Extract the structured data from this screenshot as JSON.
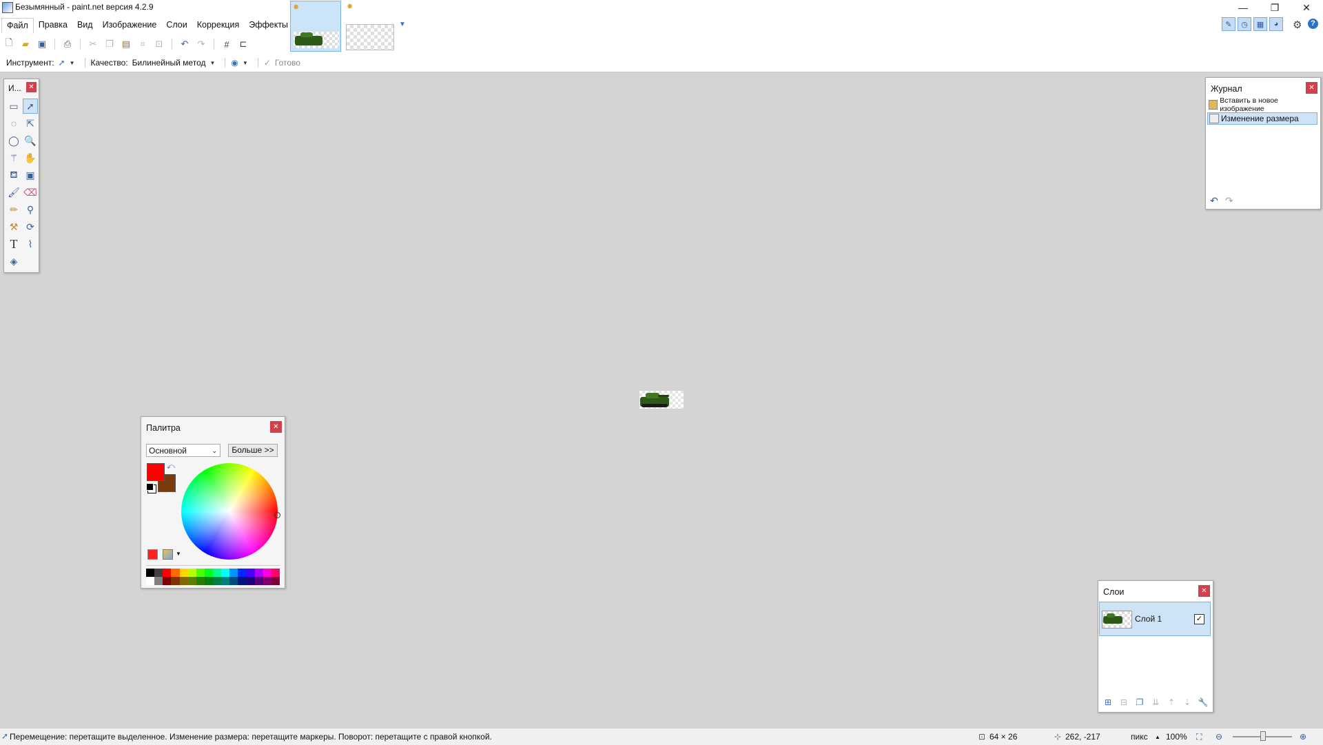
{
  "window": {
    "title": "Безымянный - paint.net версия 4.2.9",
    "minimize": "—",
    "restore": "❐",
    "close": "✕"
  },
  "menu": [
    "Файл",
    "Правка",
    "Вид",
    "Изображение",
    "Слои",
    "Коррекция",
    "Эффекты"
  ],
  "options_bar": {
    "tool_label": "Инструмент:",
    "quality_label": "Качество:",
    "quality_value": "Билинейный метод",
    "done_label": "Готово"
  },
  "tools_panel": {
    "title": "И..."
  },
  "journal": {
    "title": "Журнал",
    "items": [
      "Вставить в новое изображение",
      "Изменение размера"
    ]
  },
  "palette": {
    "title": "Палитра",
    "mode": "Основной",
    "more_button": "Больше >>",
    "primary_color": "#ff0000",
    "secondary_color": "#7b3a0c",
    "colors_top": [
      "#000000",
      "#404040",
      "#ff0000",
      "#ff6a00",
      "#ffd800",
      "#b6ff00",
      "#4cff00",
      "#00ff21",
      "#00ff90",
      "#00ffff",
      "#0094ff",
      "#0026ff",
      "#4800ff",
      "#b200ff",
      "#ff00dc",
      "#ff006e"
    ],
    "colors_bottom": [
      "#ffffff",
      "#808080",
      "#7f0000",
      "#7f3300",
      "#7f6a00",
      "#5b7f00",
      "#267f00",
      "#007f0e",
      "#007f46",
      "#007f7f",
      "#004a7f",
      "#00137f",
      "#21007f",
      "#57007f",
      "#7f006e",
      "#7f0037"
    ]
  },
  "layers": {
    "title": "Слои",
    "items": [
      {
        "name": "Слой 1",
        "visible": true
      }
    ]
  },
  "status": {
    "hint": "Перемещение: перетащите выделенное. Изменение размера: перетащите маркеры. Поворот: перетащите с правой кнопкой.",
    "size": "64 × 26",
    "coords": "262, -217",
    "units": "пикс",
    "zoom": "100%"
  }
}
